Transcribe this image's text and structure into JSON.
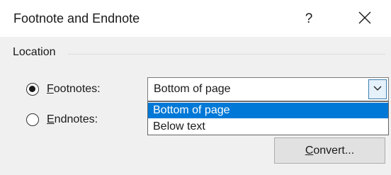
{
  "window": {
    "title": "Footnote and Endnote",
    "help_label": "?",
    "close_icon": "close-icon"
  },
  "location": {
    "group_label": "Location",
    "footnotes": {
      "mnemonic": "F",
      "rest": "ootnotes:",
      "checked": true
    },
    "endnotes": {
      "mnemonic": "E",
      "rest": "ndnotes:",
      "checked": false
    },
    "footnote_position": {
      "selected_value": "Bottom of page",
      "options": [
        "Bottom of page",
        "Below text"
      ],
      "highlighted_index": 0
    }
  },
  "convert_button": {
    "mnemonic": "C",
    "rest": "onvert..."
  },
  "colors": {
    "selection": "#0078d7",
    "dialog_bg": "#f0f0f0",
    "dropdown_arrow_bg": "#e5f1fb"
  }
}
